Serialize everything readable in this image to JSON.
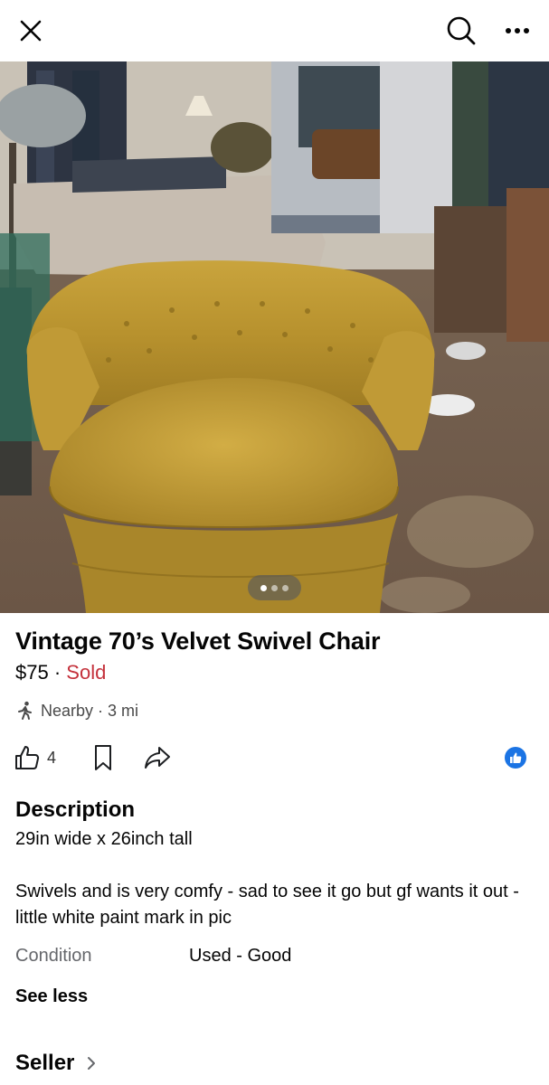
{
  "header": {
    "close_icon": "close-icon",
    "search_icon": "search-icon",
    "more_icon": "more-dots-icon"
  },
  "photo": {
    "alt": "mustard velvet tufted swivel chair",
    "carousel": {
      "total": 3,
      "active": 1
    }
  },
  "listing": {
    "title": "Vintage 70’s Velvet Swivel Chair",
    "price": "$75",
    "separator": " · ",
    "status": "Sold",
    "status_color": "#c4313b",
    "location": "Nearby · 3 mi"
  },
  "actions": {
    "like_count": "4",
    "accent_color": "#1b74e4"
  },
  "description": {
    "heading": "Description",
    "dimensions": "29in wide x 26inch tall",
    "body": "Swivels and is very comfy - sad to see it go but gf wants it out - little white paint mark in pic",
    "condition_label": "Condition",
    "condition_value": "Used - Good",
    "see_less": "See less"
  },
  "seller": {
    "heading": "Seller"
  }
}
